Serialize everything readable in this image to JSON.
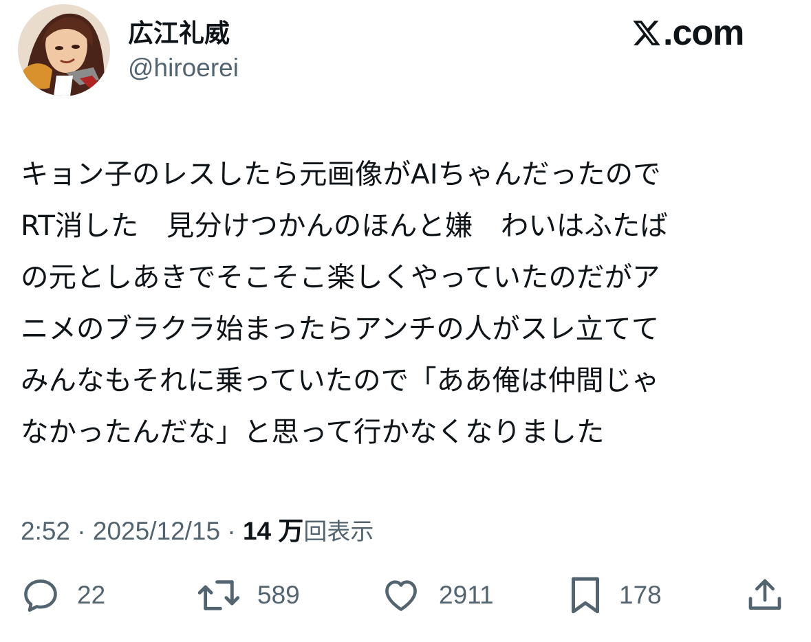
{
  "author": {
    "display_name": "広江礼威",
    "handle": "@hiroerei"
  },
  "brand": {
    "text": ".com",
    "icon": "x-logo-icon"
  },
  "tweet": {
    "lines": [
      "キョン子のレスしたら元画像がAIちゃんだったので",
      "RT消した　見分けつかんのほんと嫌　わいはふたば",
      "の元としあきでそこそこ楽しくやっていたのだがア",
      "ニメのブラクラ始まったらアンチの人がスレ立てて",
      "みんなもそれに乗っていたので「ああ俺は仲間じゃ",
      "なかったんだな」と思って行かなくなりました"
    ]
  },
  "meta": {
    "time": "2:52",
    "separator": " · ",
    "date": "2025/12/15",
    "views_count": "14 万",
    "views_label": "回表示"
  },
  "actions": {
    "reply": {
      "count": "22",
      "icon": "reply-icon"
    },
    "retweet": {
      "count": "589",
      "icon": "retweet-icon"
    },
    "like": {
      "count": "2911",
      "icon": "heart-icon"
    },
    "bookmark": {
      "count": "178",
      "icon": "bookmark-icon"
    },
    "share": {
      "icon": "share-icon"
    }
  },
  "colors": {
    "text_primary": "#0f1419",
    "text_secondary": "#536471",
    "background": "#ffffff"
  }
}
